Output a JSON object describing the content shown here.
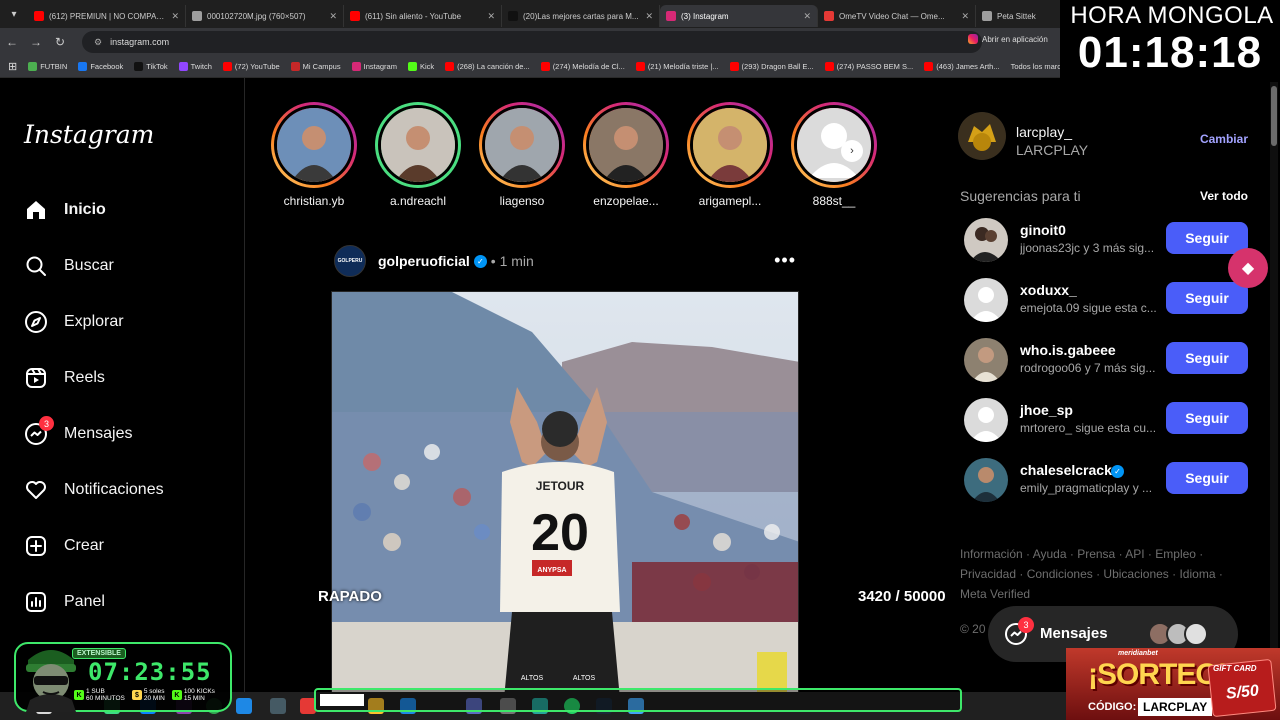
{
  "browser": {
    "tabs": [
      {
        "label": "(612) PREMIUN | NO COMPARTIR",
        "color": "#ff0000"
      },
      {
        "label": "000102720M.jpg (760×507)",
        "color": "#9e9e9e"
      },
      {
        "label": "(611) Sin aliento - YouTube",
        "color": "#ff0000"
      },
      {
        "label": "(20)Las mejores cartas para M...",
        "color": "#111111"
      },
      {
        "label": "(3) Instagram",
        "color": "#d62976"
      },
      {
        "label": "OmeTV Video Chat — Ome...",
        "color": "#e53935"
      },
      {
        "label": "Peta Sittek",
        "color": "#9e9e9e"
      }
    ],
    "url": "instagram.com",
    "open_app": "Abrir en aplicación",
    "bookmarks": [
      {
        "label": "FUTBIN",
        "color": "#4caf50"
      },
      {
        "label": "Facebook",
        "color": "#1877f2"
      },
      {
        "label": "TikTok",
        "color": "#111111"
      },
      {
        "label": "Twitch",
        "color": "#9146ff"
      },
      {
        "label": "(72) YouTube",
        "color": "#ff0000"
      },
      {
        "label": "Mi Campus",
        "color": "#c62828"
      },
      {
        "label": "Instagram",
        "color": "#d62976"
      },
      {
        "label": "Kick",
        "color": "#53fc18"
      },
      {
        "label": "(268) La canción de...",
        "color": "#ff0000"
      },
      {
        "label": "(274) Melodía de Cl...",
        "color": "#ff0000"
      },
      {
        "label": "(21) Melodía triste |...",
        "color": "#ff0000"
      },
      {
        "label": "(293) Dragon Ball E...",
        "color": "#ff0000"
      },
      {
        "label": "(274) PASSO BEM S...",
        "color": "#ff0000"
      },
      {
        "label": "(463) James Arth...",
        "color": "#ff0000"
      }
    ],
    "bookmarks_more": "Todos los marcadores"
  },
  "sidebar": {
    "logo": "Instagram",
    "items": [
      {
        "label": "Inicio",
        "icon": "home-icon",
        "active": true
      },
      {
        "label": "Buscar",
        "icon": "search-icon"
      },
      {
        "label": "Explorar",
        "icon": "compass-icon"
      },
      {
        "label": "Reels",
        "icon": "reels-icon"
      },
      {
        "label": "Mensajes",
        "icon": "messenger-icon",
        "badge": "3"
      },
      {
        "label": "Notificaciones",
        "icon": "heart-icon"
      },
      {
        "label": "Crear",
        "icon": "plus-square-icon"
      },
      {
        "label": "Panel",
        "icon": "chart-icon"
      }
    ]
  },
  "stories": [
    {
      "name": "christian.yb",
      "ring": "gradient"
    },
    {
      "name": "a.ndreachl",
      "ring": "close"
    },
    {
      "name": "liagenso",
      "ring": "gradient"
    },
    {
      "name": "enzopelae...",
      "ring": "gradient"
    },
    {
      "name": "arigamepl...",
      "ring": "gradient"
    },
    {
      "name": "888st__",
      "ring": "gradient"
    }
  ],
  "post": {
    "avatar_text": "GOLPERU",
    "user": "golperuoficial",
    "time": "• 1 min",
    "jersey_sponsor": "JETOUR",
    "jersey_number": "20",
    "jersey_patch": "ANYPSA",
    "shorts_brand": "ALTOS"
  },
  "right": {
    "me": {
      "user": "larcplay_",
      "name": "LARCPLAY",
      "switch": "Cambiar"
    },
    "suggestions_title": "Sugerencias para ti",
    "see_all": "Ver todo",
    "suggestions": [
      {
        "user": "ginoit0",
        "sub": "jjoonas23jc y 3 más sig...",
        "verified": false,
        "avatar": "photo-couple"
      },
      {
        "user": "xoduxx_",
        "sub": "emejota.09 sigue esta c...",
        "verified": false,
        "avatar": "default"
      },
      {
        "user": "who.is.gabeee",
        "sub": "rodrogoo06 y 7 más sig...",
        "verified": false,
        "avatar": "photo-man"
      },
      {
        "user": "jhoe_sp",
        "sub": "mrtorero_ sigue esta cu...",
        "verified": false,
        "avatar": "default"
      },
      {
        "user": "chaleselcrack",
        "sub": "emily_pragmaticplay y ...",
        "verified": true,
        "avatar": "photo-man2"
      }
    ],
    "follow_label": "Seguir",
    "footer": [
      "Información",
      "Ayuda",
      "Prensa",
      "API",
      "Empleo",
      "Privacidad",
      "Condiciones",
      "Ubicaciones",
      "Idioma",
      "Meta Verified"
    ],
    "copyright_fragment": "© 20",
    "messages_pill": {
      "label": "Mensajes",
      "badge": "3"
    }
  },
  "overlay": {
    "clock_title": "HORA MONGOLA",
    "clock_time": "01:18:18",
    "timer_tag": "EXTENSIBLE",
    "timer_time": "07:23:55",
    "timer_rates": [
      {
        "icon": "K",
        "line1": "1 SUB",
        "line2": "60 MINUTOS",
        "color": "#53fc18"
      },
      {
        "icon": "$",
        "line1": "5 soles",
        "line2": "20 MIN",
        "color": "#ffd54f"
      },
      {
        "icon": "K",
        "line1": "100 KICKs",
        "line2": "15 MIN",
        "color": "#53fc18"
      }
    ],
    "goal_label": "RAPADO",
    "goal_count": "3420  / 50000",
    "goal_current": 3420,
    "goal_total": 50000,
    "promo_brand": "meridianbet",
    "promo_title": "¡SORTEO!",
    "promo_code_label": "CÓDIGO:",
    "promo_code": "LARCPLAY",
    "gift_title": "GIFT CARD",
    "gift_amount": "S/50"
  },
  "colors": {
    "bg": "#000000",
    "follow_button": "#4a5df9",
    "accent_green": "#3ee86a",
    "story_gradient": "#d62976",
    "close_friends": "#4ade80"
  }
}
